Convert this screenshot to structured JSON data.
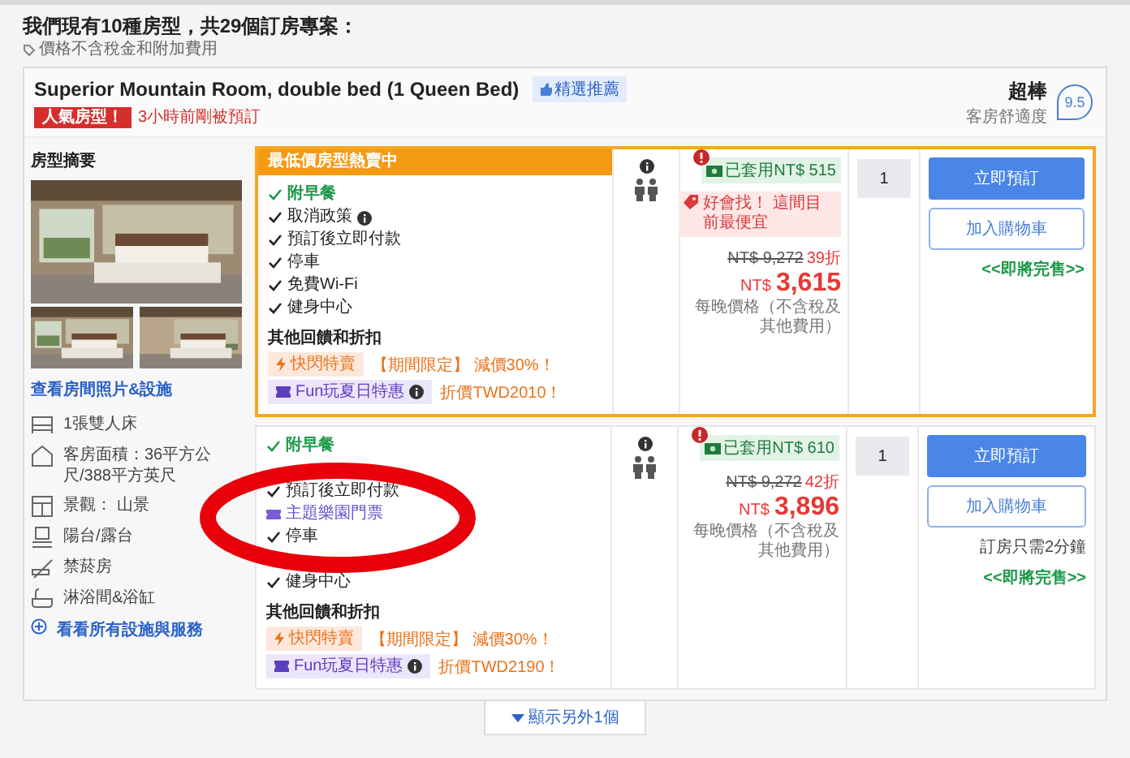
{
  "heading": "我們現有10種房型，共29個訂房專案：",
  "note": "價格不含稅金和附加費用",
  "room": {
    "name": "Superior Mountain Room, double bed (1 Queen Bed)",
    "badge": "精選推薦",
    "popular_tag": "人氣房型！",
    "recent": "3小時前剛被預訂",
    "rating_word": "超棒",
    "rating_label": "客房舒適度",
    "score": "9.5"
  },
  "summary": {
    "title": "房型摘要",
    "photos_link": "查看房間照片&設施",
    "features": [
      {
        "kind": "bed",
        "text": "1張雙人床"
      },
      {
        "kind": "area",
        "text": "客房面積：36平方公尺/388平方英尺"
      },
      {
        "kind": "view",
        "text": "景觀： 山景"
      },
      {
        "kind": "balcony",
        "text": "陽台/露台"
      },
      {
        "kind": "nosmoking",
        "text": "禁菸房"
      },
      {
        "kind": "bath",
        "text": "淋浴間&浴缸"
      }
    ],
    "all_link": "看看所有設施與服務"
  },
  "offers": [
    {
      "highlight": true,
      "banner": "最低價房型熱賣中",
      "features": [
        {
          "kind": "included",
          "text": "附早餐"
        },
        {
          "kind": "check",
          "text": "取消政策",
          "info": true
        },
        {
          "kind": "check",
          "text": "預訂後立即付款"
        },
        {
          "kind": "check",
          "text": "停車"
        },
        {
          "kind": "check",
          "text": "免費Wi-Fi"
        },
        {
          "kind": "check",
          "text": "健身中心"
        }
      ],
      "discounts_title": "其他回饋和折扣",
      "promos": [
        {
          "kind": "flash",
          "tag": "快閃特賣",
          "text": "【期間限定】 減價30%！"
        },
        {
          "kind": "fun",
          "tag": "Fun玩夏日特惠",
          "info": true,
          "text": "折價TWD2010！"
        }
      ],
      "coupon": "已套用NT$ 515",
      "deal": "好會找！ 這間目前最便宜",
      "original_price": "NT$ 9,272",
      "discount": "39折",
      "currency": "NT$",
      "price": "3,615",
      "price_note": "每晚價格（不含稅及其他費用）",
      "quantity": "1",
      "book": "立即預訂",
      "cart": "加入購物車",
      "sold_out": "<<即將完售>>"
    },
    {
      "highlight": false,
      "features": [
        {
          "kind": "included",
          "text": "附早餐"
        },
        {
          "kind": "covered"
        },
        {
          "kind": "check",
          "text": "預訂後立即付款"
        },
        {
          "kind": "ticket",
          "text": "主題樂園門票"
        },
        {
          "kind": "check",
          "text": "停車"
        },
        {
          "kind": "covered"
        },
        {
          "kind": "check",
          "text": "健身中心"
        }
      ],
      "discounts_title": "其他回饋和折扣",
      "promos": [
        {
          "kind": "flash",
          "tag": "快閃特賣",
          "text": "【期間限定】 減價30%！"
        },
        {
          "kind": "fun",
          "tag": "Fun玩夏日特惠",
          "info": true,
          "text": "折價TWD2190！"
        }
      ],
      "coupon": "已套用NT$ 610",
      "original_price": "NT$ 9,272",
      "discount": "42折",
      "currency": "NT$",
      "price": "3,896",
      "price_note": "每晚價格（不含稅及其他費用）",
      "quantity": "1",
      "book": "立即預訂",
      "cart": "加入購物車",
      "urgency": "訂房只需2分鐘",
      "sold_out": "<<即將完售>>"
    }
  ],
  "show_more": "顯示另外1個",
  "annotation": {
    "kind": "ellipse"
  }
}
